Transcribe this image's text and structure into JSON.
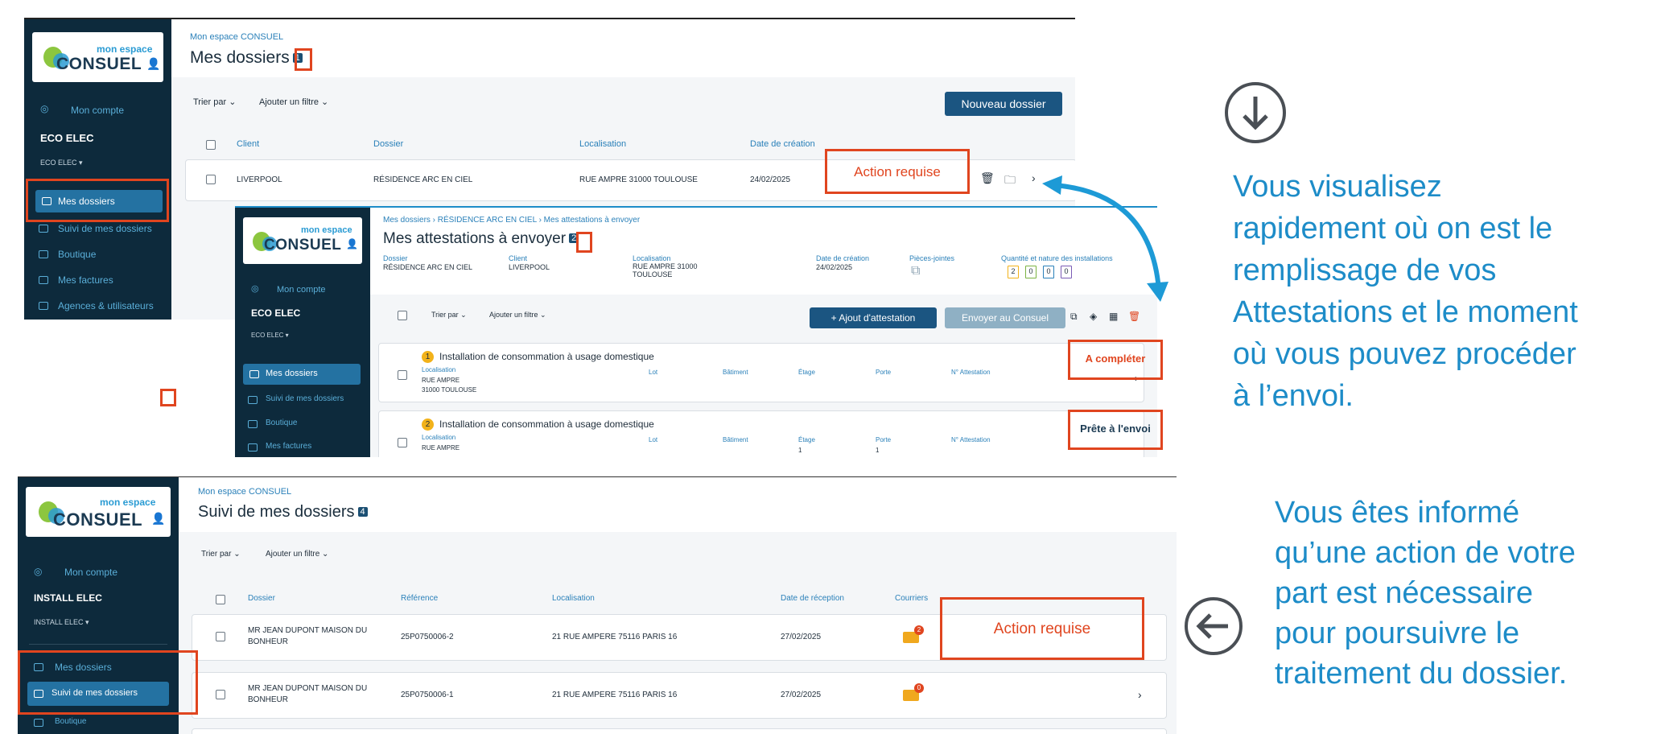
{
  "brand": {
    "small": "mon espace",
    "main": "CONSUEL"
  },
  "panel1": {
    "sidebar": {
      "account": "Mon compte",
      "company": "ECO ELEC",
      "company_sub": "ECO ELEC ▾",
      "items": [
        "Mes dossiers",
        "Suivi de mes dossiers",
        "Boutique",
        "Mes factures",
        "Agences & utilisateurs"
      ]
    },
    "breadcrumb": "Mon espace CONSUEL",
    "title": "Mes dossiers",
    "badge": "1",
    "sort": "Trier par ⌄",
    "filter": "Ajouter un filtre ⌄",
    "new_button": "Nouveau dossier",
    "columns": [
      "Client",
      "Dossier",
      "Localisation",
      "Date de création"
    ],
    "row": {
      "client": "LIVERPOOL",
      "dossier": "RÉSIDENCE ARC EN CIEL",
      "localisation": "RUE AMPRE 31000 TOULOUSE",
      "date": "24/02/2025"
    },
    "action": "Action requise"
  },
  "panel2": {
    "sidebar": {
      "account": "Mon compte",
      "company": "ECO ELEC",
      "company_sub": "ECO ELEC ▾",
      "items": [
        "Mes dossiers",
        "Suivi de mes dossiers",
        "Boutique",
        "Mes factures"
      ]
    },
    "breadcrumb": "Mes dossiers › RÉSIDENCE ARC EN CIEL › Mes attestations à envoyer",
    "title": "Mes attestations à envoyer",
    "badge": "2",
    "meta": [
      {
        "label": "Dossier",
        "value": "RÉSIDENCE ARC EN CIEL"
      },
      {
        "label": "Client",
        "value": "LIVERPOOL"
      },
      {
        "label": "Localisation",
        "value": "RUE AMPRE 31000 TOULOUSE"
      },
      {
        "label": "Date de création",
        "value": "24/02/2025"
      },
      {
        "label": "Pièces-jointes",
        "value": ""
      },
      {
        "label": "Quantité et nature des installations",
        "value": ""
      }
    ],
    "counts": [
      "2",
      "0",
      "0",
      "0"
    ],
    "count_colors": [
      "#f2b21a",
      "#7bb342",
      "#2a80b9",
      "#7a5bb5"
    ],
    "sort": "Trier par ⌄",
    "filter": "Ajouter un filtre ⌄",
    "add_button": "+ Ajout d'attestation",
    "send_button": "Envoyer au Consuel",
    "row_cols": [
      "Lot",
      "Bâtiment",
      "Étage",
      "Porte",
      "N° Attestation"
    ],
    "rows": [
      {
        "num": "1",
        "title": "Installation de consommation à usage domestique",
        "loc_label": "Localisation",
        "loc1": "RUE AMPRE",
        "loc2": "31000 TOULOUSE",
        "etage": "",
        "porte": "",
        "status": "A compléter"
      },
      {
        "num": "2",
        "title": "Installation de consommation à usage domestique",
        "loc_label": "Localisation",
        "loc1": "RUE AMPRE",
        "loc2": "",
        "etage": "1",
        "porte": "1",
        "status": "Prête à l'envoi"
      }
    ]
  },
  "panel3": {
    "sidebar": {
      "account": "Mon compte",
      "company": "INSTALL ELEC",
      "company_sub": "INSTALL ELEC ▾",
      "items": [
        "Mes dossiers",
        "Suivi de mes dossiers",
        "Boutique"
      ]
    },
    "breadcrumb": "Mon espace CONSUEL",
    "title": "Suivi de mes dossiers",
    "badge": "4",
    "sort": "Trier par ⌄",
    "filter": "Ajouter un filtre ⌄",
    "columns": [
      "Dossier",
      "Référence",
      "Localisation",
      "Date de réception",
      "Courriers"
    ],
    "rows": [
      {
        "dossier1": "MR JEAN DUPONT MAISON DU",
        "dossier2": "BONHEUR",
        "ref": "25P0750006-2",
        "loc": "21 RUE AMPERE 75116 PARIS 16",
        "date": "27/02/2025",
        "mail": "2"
      },
      {
        "dossier1": "MR JEAN DUPONT MAISON DU",
        "dossier2": "BONHEUR",
        "ref": "25P0750006-1",
        "loc": "21 RUE AMPERE 75116 PARIS 16",
        "date": "27/02/2025",
        "mail": "0"
      }
    ],
    "action": "Action requise"
  },
  "text1": [
    "Vous visualisez",
    "rapidement où on est le",
    "remplissage de vos",
    "Attestations et le moment",
    "où vous pouvez procéder",
    "à l’envoi."
  ],
  "text2": [
    "Vous êtes informé",
    "qu’une action de votre",
    "part est nécessaire",
    "pour poursuivre le",
    "traitement du dossier."
  ],
  "colors": {
    "accent": "#1d8cc8",
    "highlight": "#e0451f",
    "sidebar": "#0d2a3c",
    "primary_button": "#1b5581"
  }
}
